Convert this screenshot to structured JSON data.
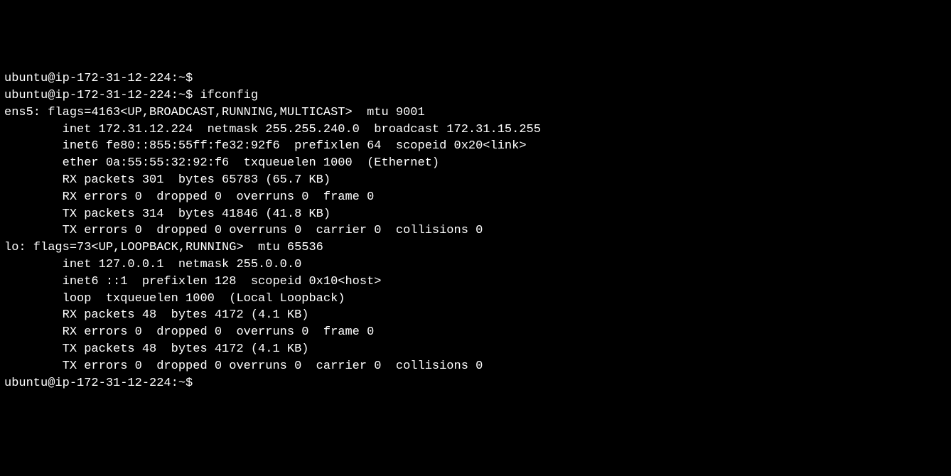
{
  "lines": [
    {
      "prompt": "ubuntu@ip-172-31-12-224:~$ ",
      "cmd": ""
    },
    {
      "prompt": "ubuntu@ip-172-31-12-224:~$ ",
      "cmd": "ifconfig"
    },
    {
      "text": "ens5: flags=4163<UP,BROADCAST,RUNNING,MULTICAST>  mtu 9001"
    },
    {
      "text": "        inet 172.31.12.224  netmask 255.255.240.0  broadcast 172.31.15.255"
    },
    {
      "text": "        inet6 fe80::855:55ff:fe32:92f6  prefixlen 64  scopeid 0x20<link>"
    },
    {
      "text": "        ether 0a:55:55:32:92:f6  txqueuelen 1000  (Ethernet)"
    },
    {
      "text": "        RX packets 301  bytes 65783 (65.7 KB)"
    },
    {
      "text": "        RX errors 0  dropped 0  overruns 0  frame 0"
    },
    {
      "text": "        TX packets 314  bytes 41846 (41.8 KB)"
    },
    {
      "text": "        TX errors 0  dropped 0 overruns 0  carrier 0  collisions 0"
    },
    {
      "text": ""
    },
    {
      "text": "lo: flags=73<UP,LOOPBACK,RUNNING>  mtu 65536"
    },
    {
      "text": "        inet 127.0.0.1  netmask 255.0.0.0"
    },
    {
      "text": "        inet6 ::1  prefixlen 128  scopeid 0x10<host>"
    },
    {
      "text": "        loop  txqueuelen 1000  (Local Loopback)"
    },
    {
      "text": "        RX packets 48  bytes 4172 (4.1 KB)"
    },
    {
      "text": "        RX errors 0  dropped 0  overruns 0  frame 0"
    },
    {
      "text": "        TX packets 48  bytes 4172 (4.1 KB)"
    },
    {
      "text": "        TX errors 0  dropped 0 overruns 0  carrier 0  collisions 0"
    },
    {
      "text": ""
    },
    {
      "prompt": "ubuntu@ip-172-31-12-224:~$ ",
      "cmd": ""
    }
  ]
}
